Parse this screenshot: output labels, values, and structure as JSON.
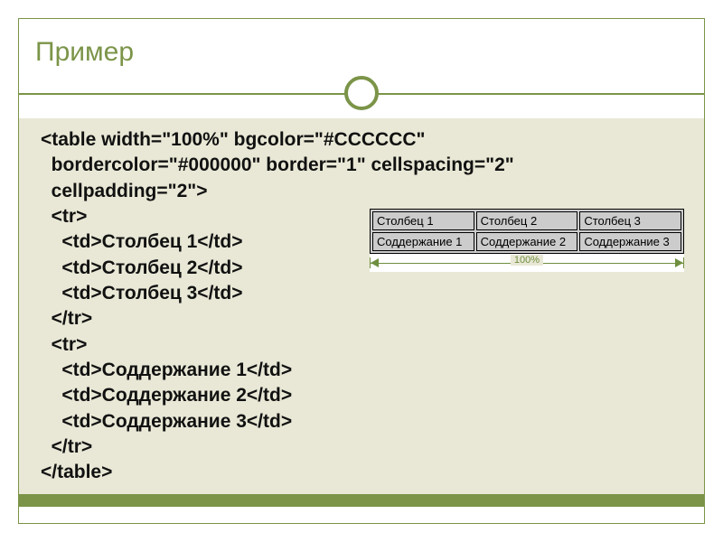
{
  "title": "Пример",
  "code": {
    "l1": "<table width=\"100%\" bgcolor=\"#CCCCCC\"",
    "l2": "  bordercolor=\"#000000\" border=\"1\" cellspacing=\"2\"",
    "l3": "  cellpadding=\"2\">",
    "l4": "  <tr>",
    "l5": "    <td>Столбец 1</td>",
    "l6": "    <td>Столбец 2</td>",
    "l7": "    <td>Столбец 3</td>",
    "l8": "  </tr>",
    "l9": "  <tr>",
    "l10": "    <td>Соддержание 1</td>",
    "l11": "    <td>Соддержание 2</td>",
    "l12": "    <td>Соддержание 3</td>",
    "l13": "  </tr>",
    "l14": "</table>"
  },
  "example": {
    "row1": {
      "c1": "Столбец 1",
      "c2": "Столбец 2",
      "c3": "Столбец 3"
    },
    "row2": {
      "c1": "Соддержание 1",
      "c2": "Соддержание 2",
      "c3": "Соддержание 3"
    },
    "dim_label": "100%"
  }
}
